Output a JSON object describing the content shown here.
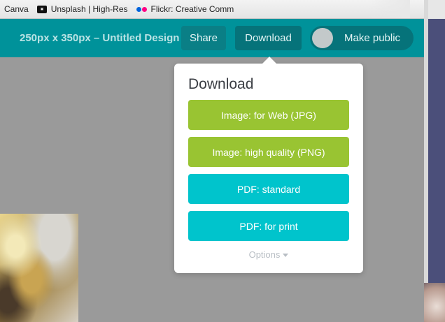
{
  "bookmarks": [
    {
      "label": "Canva"
    },
    {
      "label": "Unsplash | High-Res"
    },
    {
      "label": "Flickr: Creative Comm"
    }
  ],
  "header": {
    "title": "250px x 350px – Untitled Design",
    "share_label": "Share",
    "download_label": "Download",
    "make_public_label": "Make public"
  },
  "popup": {
    "title": "Download",
    "options": [
      {
        "label": "Image: for Web (JPG)",
        "color": "#99c432"
      },
      {
        "label": "Image: high quality (PNG)",
        "color": "#99c432"
      },
      {
        "label": "PDF: standard",
        "color": "#00c4cc"
      },
      {
        "label": "PDF: for print",
        "color": "#00c4cc"
      }
    ],
    "more_label": "Options"
  },
  "colors": {
    "header": "#00929a",
    "green": "#99c432",
    "cyan": "#00c4cc"
  }
}
